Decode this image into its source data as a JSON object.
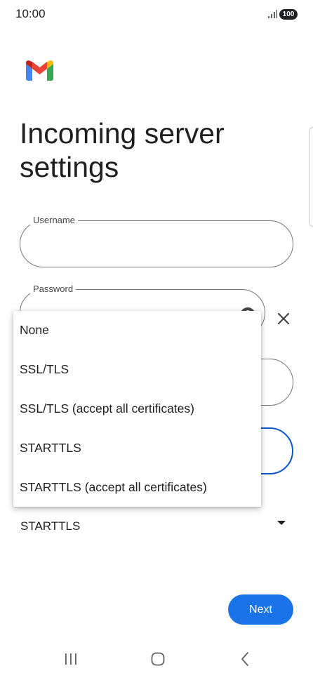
{
  "status_bar": {
    "time": "10:00",
    "battery": "100"
  },
  "screen": {
    "title": "Incoming server settings"
  },
  "fields": {
    "username_label": "Username",
    "password_label": "Password"
  },
  "security": {
    "selected": "STARTTLS",
    "options": [
      "None",
      "SSL/TLS",
      "SSL/TLS (accept all certificates)",
      "STARTTLS",
      "STARTTLS (accept all certificates)"
    ]
  },
  "actions": {
    "next_label": "Next"
  },
  "colors": {
    "accent": "#1a73e8",
    "focus": "#0b57d0",
    "text": "#1f1f1f"
  },
  "icons": [
    "gmail-logo",
    "eye-icon",
    "close-icon",
    "dropdown-arrow-icon",
    "recents-icon",
    "home-icon",
    "back-icon"
  ]
}
